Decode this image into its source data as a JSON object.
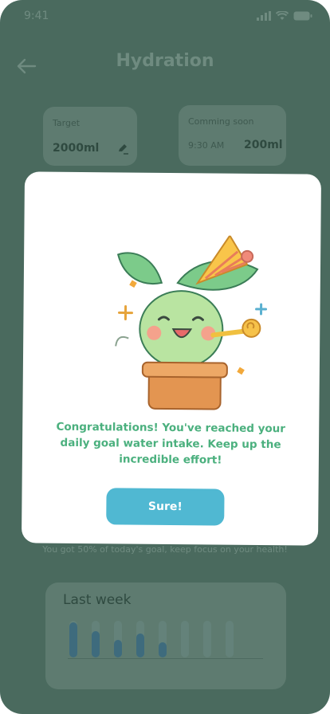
{
  "status_bar": {
    "time": "9:41"
  },
  "header": {
    "title": "Hydration"
  },
  "target_card": {
    "label": "Target",
    "value": "2000ml"
  },
  "coming_card": {
    "label": "Comming soon",
    "time": "9:30 AM",
    "value": "200ml"
  },
  "progress_text": "You got 50% of today's goal, keep focus on your health!",
  "last_week": {
    "title": "Last week",
    "bars": [
      0.95,
      0.72,
      0.48,
      0.65,
      0.42,
      0,
      0,
      0
    ]
  },
  "modal": {
    "message": "Congratulations! You've reached your daily goal water intake. Keep up the incredible effort!",
    "button_label": "Sure!"
  },
  "colors": {
    "accent_green": "#4bb07e",
    "button_blue": "#50b8d2",
    "overlay_bg": "#4a6a5e"
  }
}
